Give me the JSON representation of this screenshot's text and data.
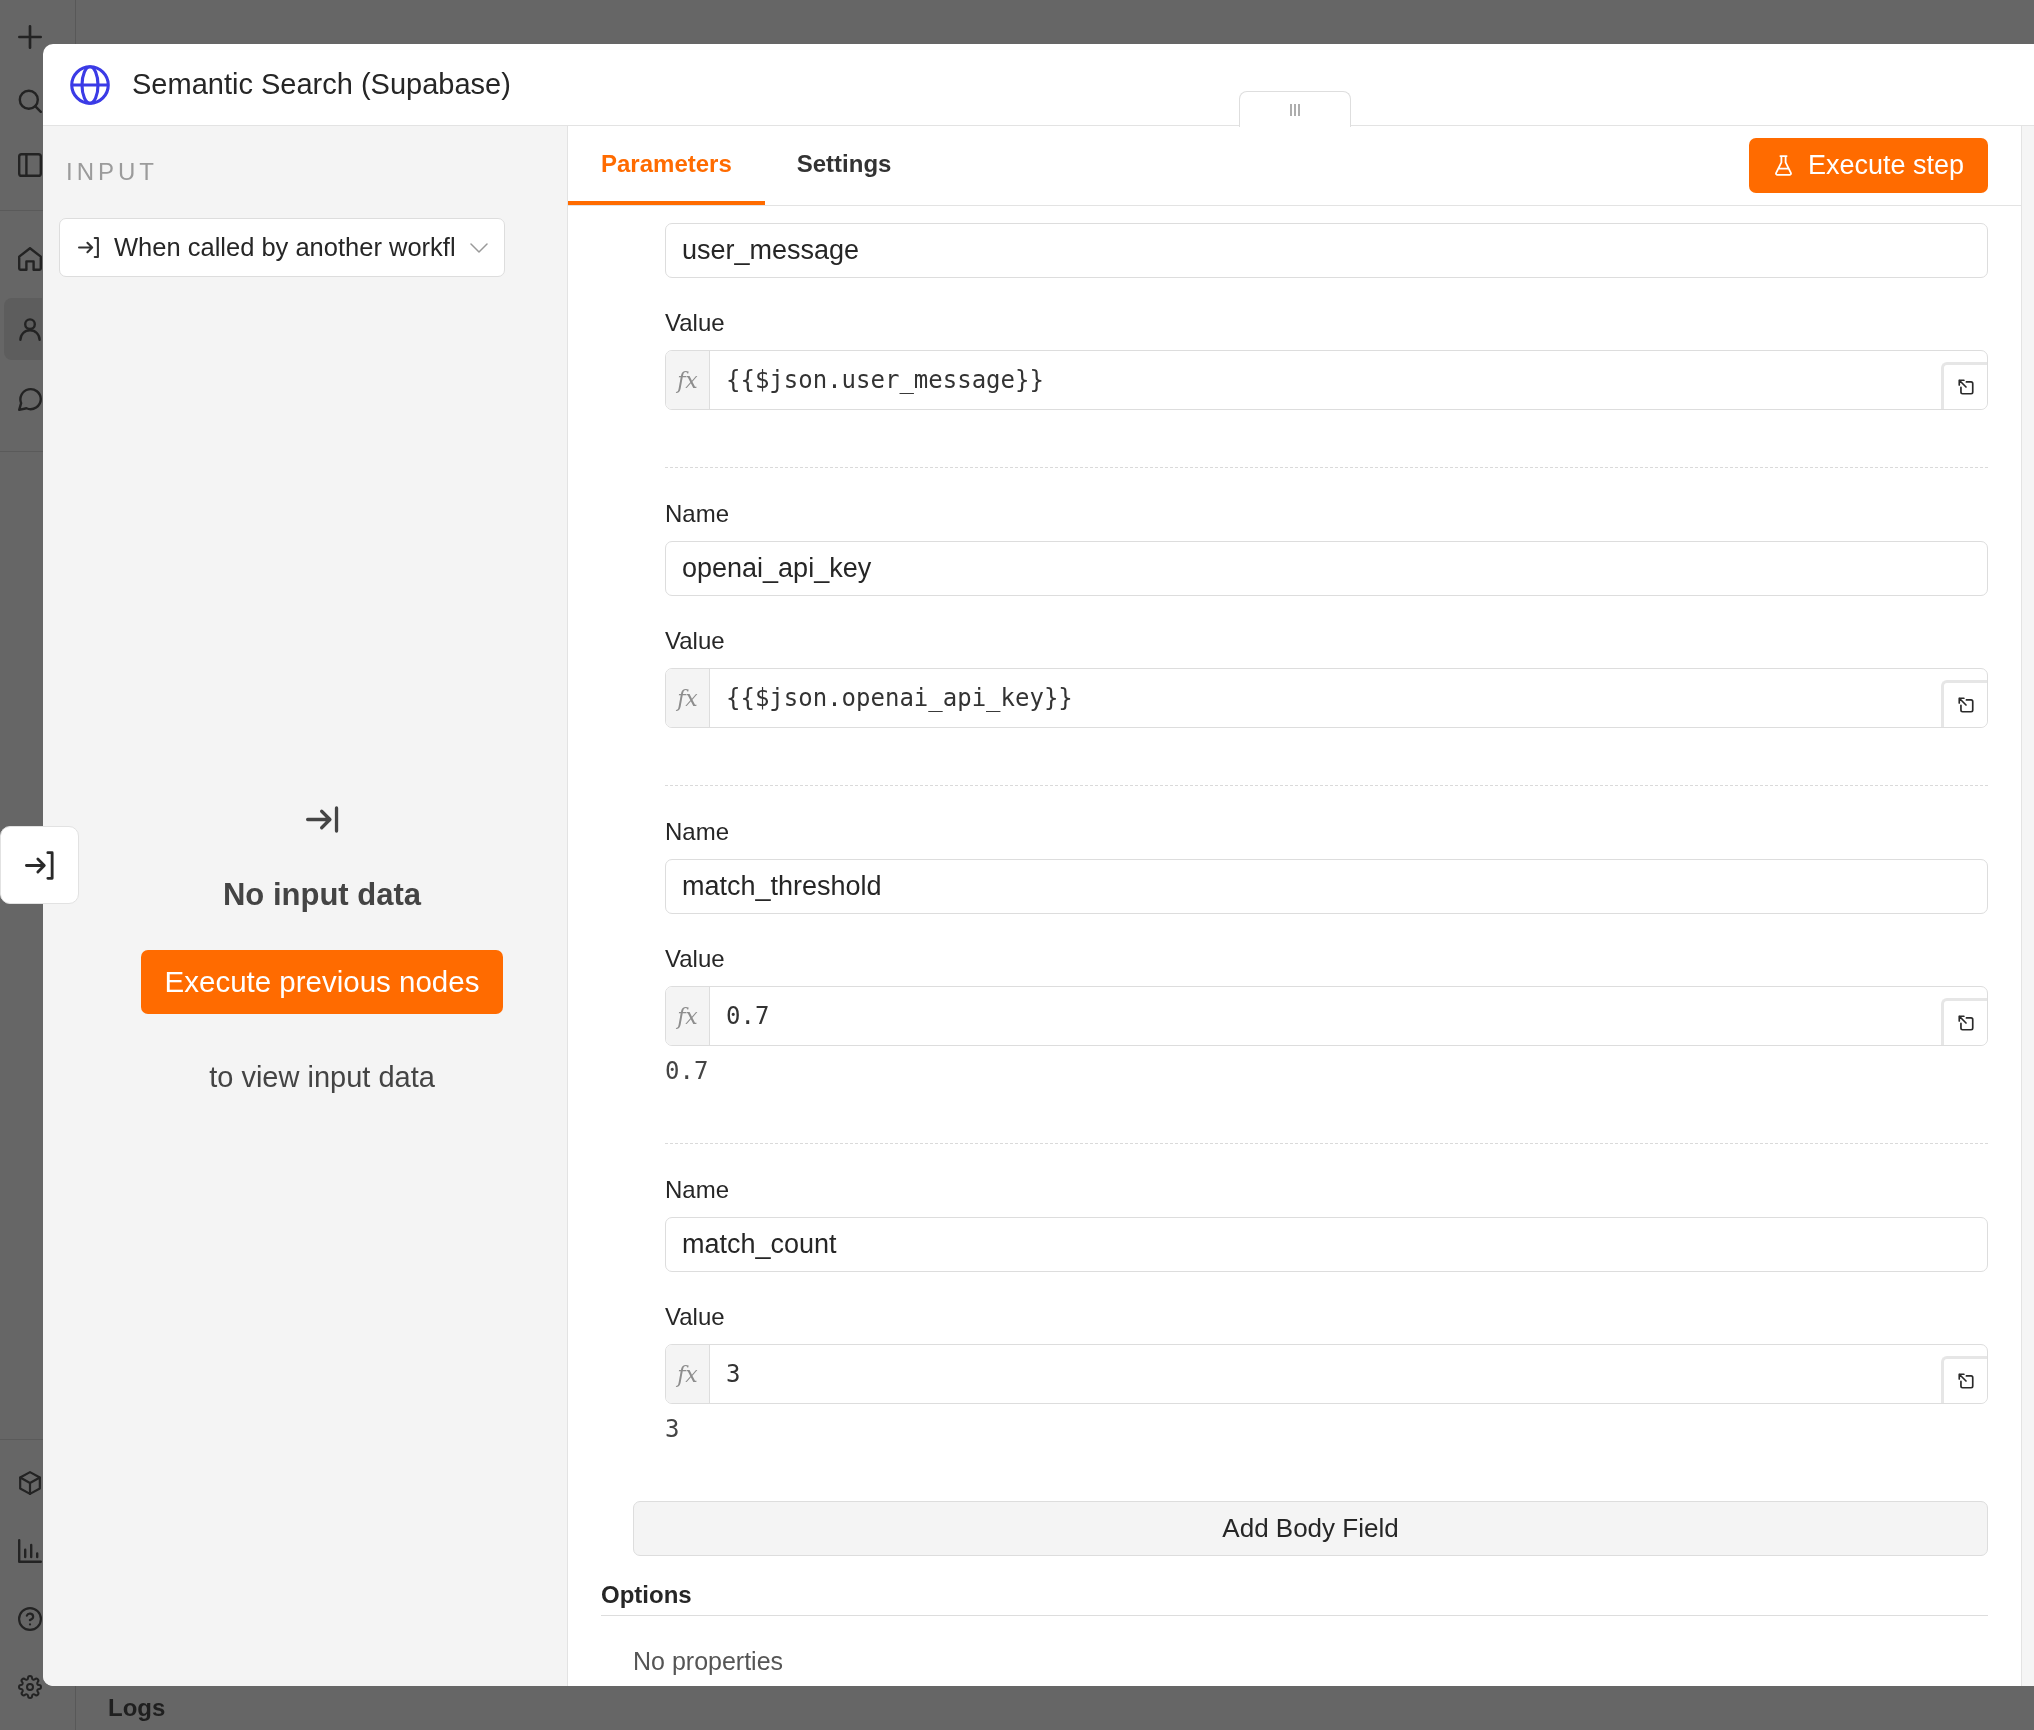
{
  "app_sidebar": {
    "items": [
      {
        "selected": false
      },
      {
        "selected": true
      },
      {
        "selected": false
      }
    ]
  },
  "logs_bar": {
    "title": "Logs"
  },
  "node_window": {
    "title": "Semantic Search (Supabase)"
  },
  "input_panel": {
    "heading": "INPUT",
    "trigger_select": {
      "value": "When called by another workfl"
    },
    "empty_state": {
      "title": "No input data",
      "button": "Execute previous nodes",
      "note": "to view input data"
    }
  },
  "parameters_panel": {
    "tabs": [
      {
        "label": "Parameters",
        "selected": true
      },
      {
        "label": "Settings",
        "selected": false
      }
    ],
    "execute_button": "Execute step",
    "body_fields": [
      {
        "name": "user_message",
        "value_label": "Value",
        "prefix": "fx",
        "value": "{{$json.user_message}}"
      },
      {
        "name_label": "Name",
        "name": "openai_api_key",
        "value_label": "Value",
        "prefix": "fx",
        "value": "{{$json.openai_api_key}}"
      },
      {
        "name_label": "Name",
        "name": "match_threshold",
        "value_label": "Value",
        "prefix": "fx",
        "value": "0.7",
        "hint": "0.7"
      },
      {
        "name_label": "Name",
        "name": "match_count",
        "value_label": "Value",
        "prefix": "fx",
        "value": "3",
        "hint": "3"
      }
    ],
    "add_button": "Add Body Field",
    "options": {
      "heading": "Options",
      "empty_text": "No properties"
    }
  }
}
